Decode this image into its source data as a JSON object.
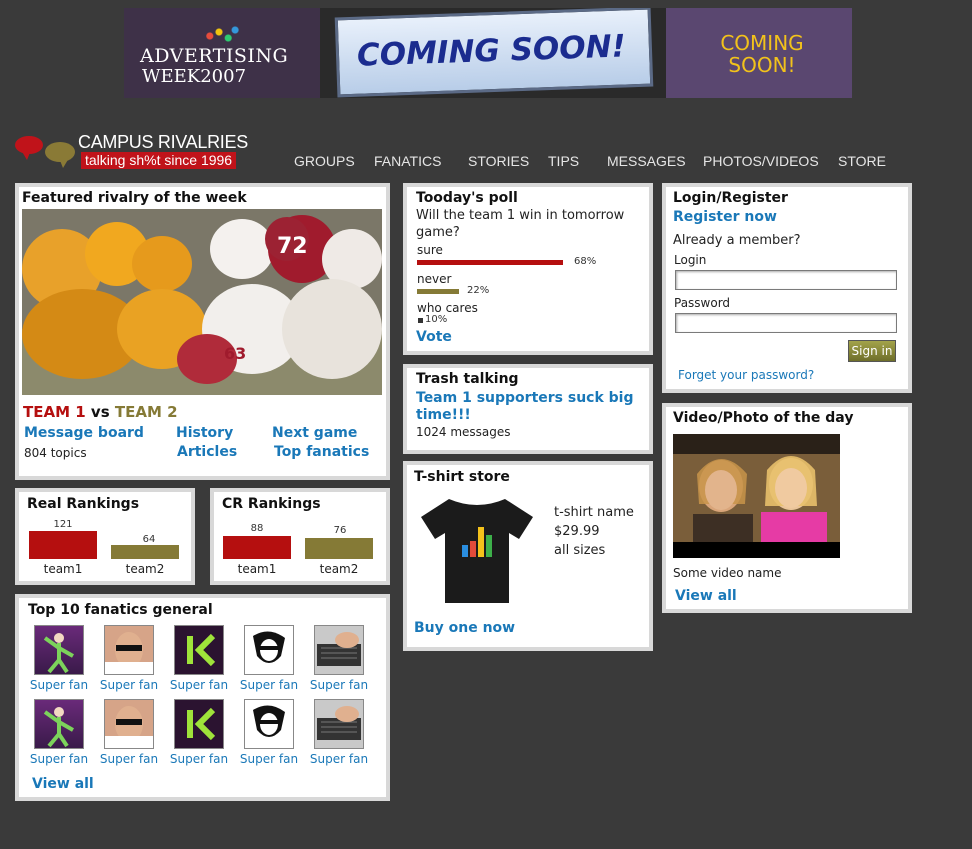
{
  "banner": {
    "brand_line1": "ADVERTISING",
    "brand_line2": "WEEK2007",
    "sign_text": "COMING SOON!",
    "right_text": "COMING SOON!"
  },
  "logo": {
    "name": "CAMPUS RIVALRIES",
    "tagline": "talking sh%t since 1996"
  },
  "nav": [
    "GROUPS",
    "FANATICS",
    "STORIES",
    "TIPS",
    "MESSAGES",
    "PHOTOS/VIDEOS",
    "STORE"
  ],
  "featured": {
    "title": "Featured rivalry of the week",
    "team1": "TEAM 1",
    "vs": "vs",
    "team2": "TEAM 2",
    "message_board": "Message board",
    "topics": "804 topics",
    "history": "History",
    "articles": "Articles",
    "next_game": "Next game",
    "top_fanatics": "Top fanatics"
  },
  "real_rankings": {
    "title": "Real Rankings",
    "bars": [
      {
        "value": "121",
        "label": "team1",
        "color": "#b50f0f"
      },
      {
        "value": "64",
        "label": "team2",
        "color": "#857a36"
      }
    ]
  },
  "cr_rankings": {
    "title": "CR Rankings",
    "bars": [
      {
        "value": "88",
        "label": "team1",
        "color": "#b50f0f"
      },
      {
        "value": "76",
        "label": "team2",
        "color": "#857a36"
      }
    ]
  },
  "fanatics": {
    "title": "Top 10 fanatics general",
    "label": "Super fan",
    "view_all": "View all"
  },
  "poll": {
    "title": "Tooday's poll",
    "question": "Will the team 1 win in tomorrow game?",
    "options": [
      {
        "label": "sure",
        "pct": "68%",
        "color": "#b50f0f"
      },
      {
        "label": "never",
        "pct": "22%",
        "color": "#857a36"
      },
      {
        "label": "who cares",
        "pct": "10%",
        "color": "#333333"
      }
    ],
    "vote": "Vote"
  },
  "trash": {
    "title": "Trash talking",
    "headline": "Team 1 supporters suck big time!!!",
    "messages": "1024 messages"
  },
  "tshirt": {
    "title": "T-shirt store",
    "name": "t-shirt name",
    "price": "$29.99",
    "sizes": "all sizes",
    "buy": "Buy one now"
  },
  "login": {
    "title": "Login/Register",
    "register": "Register now",
    "already": "Already a member?",
    "login_label": "Login",
    "password_label": "Password",
    "signin": "Sign in",
    "forgot": "Forget your password?"
  },
  "video": {
    "title": "Video/Photo of the day",
    "caption": "Some video name",
    "view_all": "View all"
  }
}
